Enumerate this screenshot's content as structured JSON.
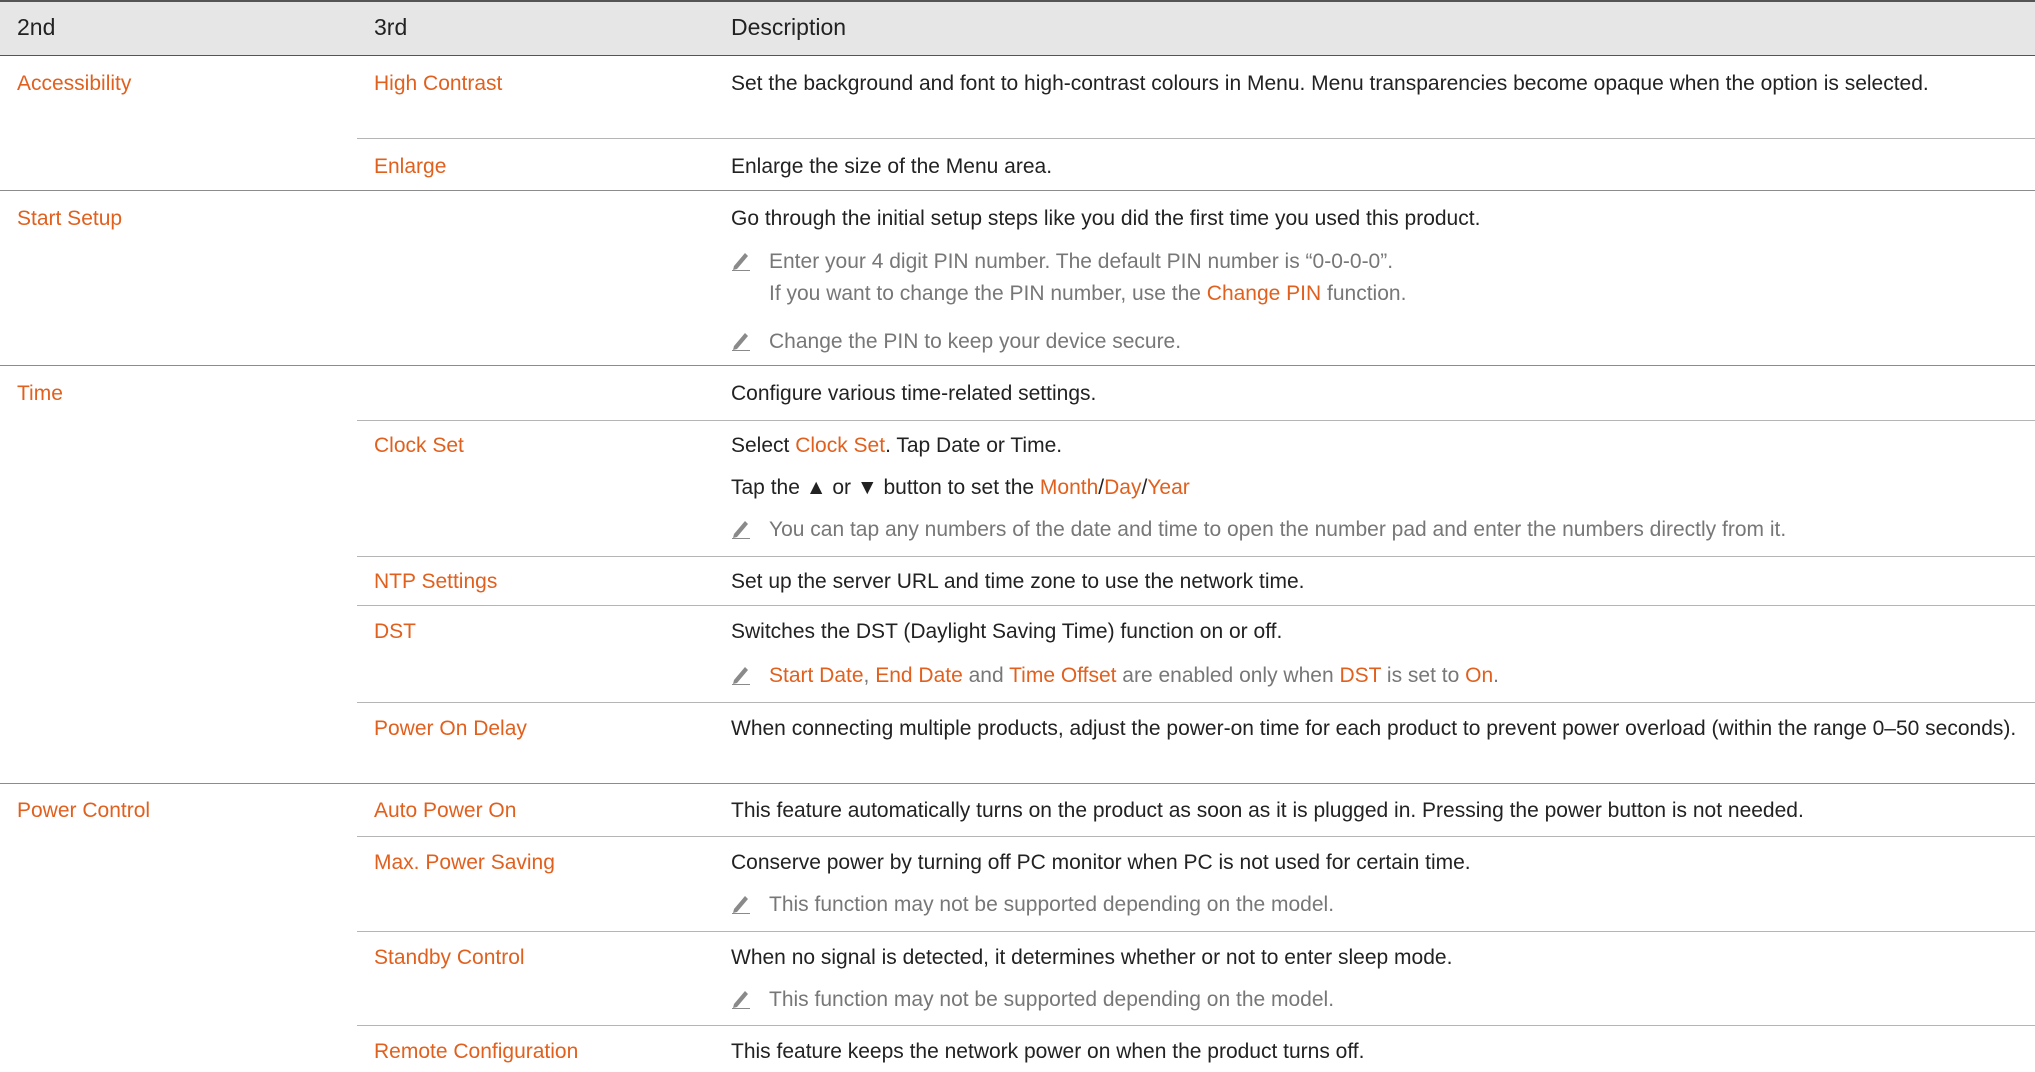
{
  "header": {
    "col1": "2nd",
    "col2": "3rd",
    "col3": "Description"
  },
  "rows": {
    "accessibility": "Accessibility",
    "high_contrast": "High Contrast",
    "high_contrast_desc": "Set the background and font to high-contrast colours in Menu.  Menu transparencies become opaque when the option is selected.",
    "enlarge": "Enlarge",
    "enlarge_desc": "Enlarge the size of the Menu area.",
    "start_setup": "Start Setup",
    "start_setup_desc": "Go through the initial setup steps like you did the first time you used this product.",
    "start_setup_note1_a": "Enter your 4 digit PIN number. The default PIN number is “0-0-0-0”.",
    "start_setup_note1_b_pre": "If you want to change the PIN number, use the ",
    "start_setup_note1_b_link": "Change PIN",
    "start_setup_note1_b_post": " function.",
    "start_setup_note2": "Change the PIN to keep your device secure.",
    "time": "Time",
    "time_desc": "Configure various time-related settings.",
    "clock_set": "Clock Set",
    "clock_set_desc_pre": "Select ",
    "clock_set_desc_link": "Clock Set",
    "clock_set_desc_post": ". Tap Date or Time.",
    "clock_set_tap_pre": "Tap the ▲ or ▼ button to set the ",
    "clock_set_month": "Month",
    "clock_set_day": "Day",
    "clock_set_year": "Year",
    "slash": "/",
    "clock_set_note": "You can tap any numbers of the date and time to open the number pad and enter the numbers directly from it.",
    "ntp_settings": "NTP Settings",
    "ntp_settings_desc": "Set up the server URL and time zone to use the network time.",
    "dst": "DST",
    "dst_desc": "Switches the DST (Daylight Saving Time) function on or off.",
    "dst_note_start": "Start Date",
    "dst_note_comma": ", ",
    "dst_note_end": "End Date",
    "dst_note_and": " and ",
    "dst_note_offset": "Time Offset",
    "dst_note_mid": " are enabled only when ",
    "dst_note_dst": "DST",
    "dst_note_set": " is set to ",
    "dst_note_on": "On",
    "dst_note_period": ".",
    "power_on_delay": "Power On Delay",
    "power_on_delay_desc": "When connecting multiple products, adjust the power-on time for each product to prevent power overload (within the range 0–50 seconds).",
    "power_control": "Power Control",
    "auto_power_on": "Auto Power On",
    "auto_power_on_desc": "This feature automatically turns on the product as soon as it is plugged in. Pressing the power button is not needed.",
    "max_power_saving": "Max. Power Saving",
    "max_power_saving_desc": "Conserve power by turning off PC monitor when PC is not used for certain time.",
    "max_power_saving_note": "This function may not be supported depending on the model.",
    "standby_control": "Standby Control",
    "standby_control_desc": "When no signal is detected, it determines whether or not to enter sleep mode.",
    "standby_control_note": "This function may not be supported depending on the model.",
    "remote_configuration": "Remote Configuration",
    "remote_configuration_desc": "This feature keeps the network power on when the product turns off."
  },
  "colors": {
    "accent": "#e1601e",
    "text": "#222222",
    "note": "#777777",
    "header_bg": "#e6e6e6"
  },
  "icons": {
    "note": "pencil-icon"
  }
}
